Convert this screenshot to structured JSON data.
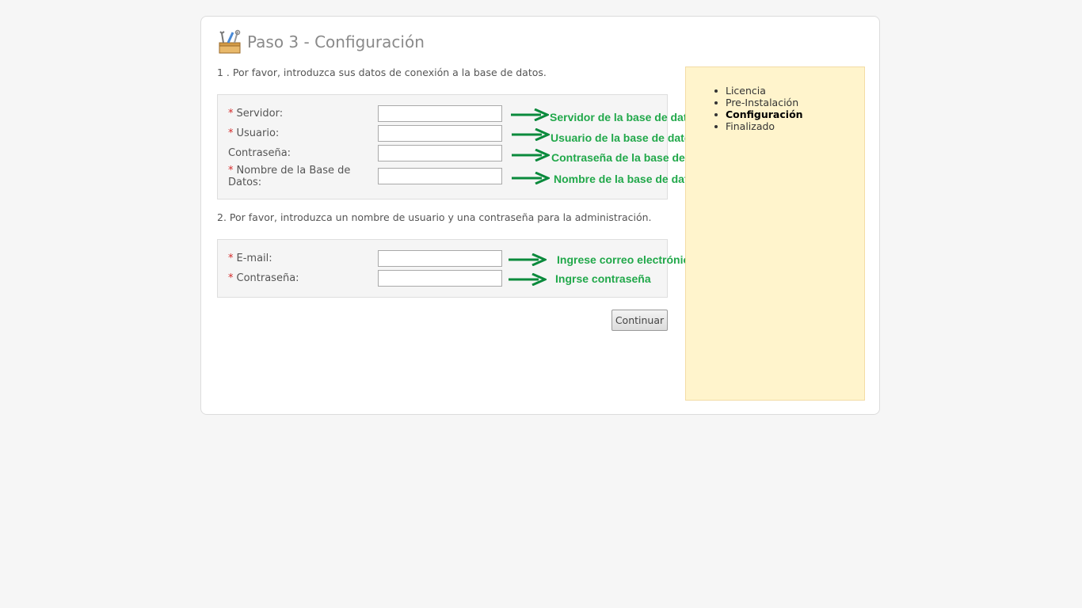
{
  "page": {
    "title": "Paso 3 - Configuración",
    "title_icon": "toolbox-icon"
  },
  "section1": {
    "intro": "1 . Por favor, introduzca sus datos de conexión a la base de datos.",
    "fields": [
      {
        "label": "Servidor:",
        "required": true,
        "value": "",
        "note": "Servidor de la base de datos"
      },
      {
        "label": "Usuario:",
        "required": true,
        "value": "",
        "note": "Usuario de la base de datos"
      },
      {
        "label": "Contraseña:",
        "required": false,
        "value": "",
        "note": "Contraseña de la base de datos"
      },
      {
        "label": "Nombre de la Base de Datos:",
        "required": true,
        "value": "",
        "note": "Nombre de la base de datos"
      }
    ]
  },
  "section2": {
    "intro": "2. Por favor, introduzca un nombre de usuario y una contraseña para la administración.",
    "fields": [
      {
        "label": "E-mail:",
        "required": true,
        "value": "",
        "note": "Ingrese correo electrónico"
      },
      {
        "label": "Contraseña:",
        "required": true,
        "value": "",
        "note": "Ingrse contraseña"
      }
    ]
  },
  "required_marker": "*",
  "continue_label": "Continuar",
  "steps": [
    {
      "label": "Licencia",
      "active": false
    },
    {
      "label": "Pre-Instalación",
      "active": false
    },
    {
      "label": "Configuración",
      "active": true
    },
    {
      "label": "Finalizado",
      "active": false
    }
  ],
  "colors": {
    "annotation": "#21a84a",
    "arrow": "#0a8a3c",
    "required": "#d42a2a",
    "sidebar_bg": "#fff4cc"
  }
}
